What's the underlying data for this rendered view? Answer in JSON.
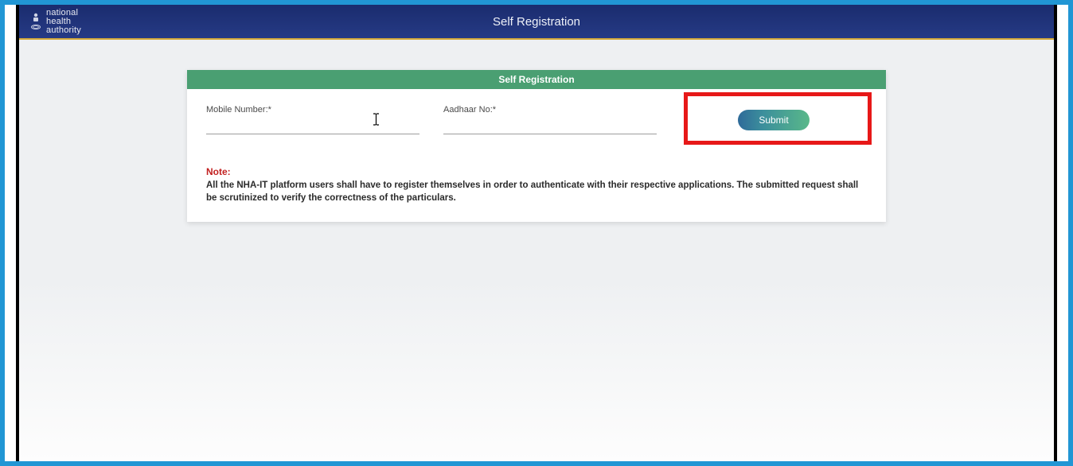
{
  "header": {
    "brand_line1": "national",
    "brand_line2": "health",
    "brand_line3": "authority",
    "title": "Self Registration"
  },
  "card": {
    "title": "Self Registration",
    "fields": {
      "mobile": {
        "label": "Mobile Number:*",
        "value": ""
      },
      "aadhaar": {
        "label": "Aadhaar No:*",
        "value": ""
      }
    },
    "submit_label": "Submit",
    "note_label": "Note:",
    "note_text": "All the NHA-IT platform users shall have to register themselves in order to authenticate with their respective applications. The submitted request shall be scrutinized to verify the correctness of the particulars."
  }
}
